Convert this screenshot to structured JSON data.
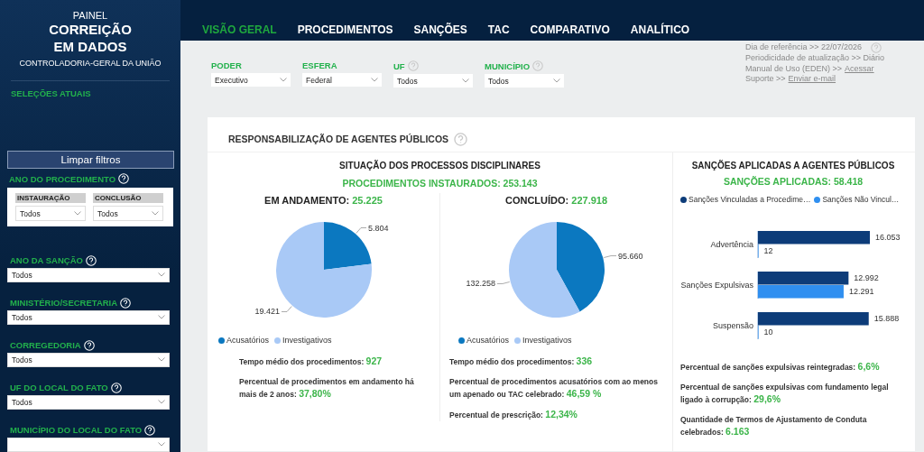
{
  "sidebar": {
    "logo": {
      "line_1": "PAINEL",
      "line_2": "CORREIÇÃO",
      "line_3": "EM DADOS",
      "line_4": "CONTROLADORIA-GERAL DA UNIÃO"
    },
    "selections_title": "SELEÇÕES ATUAIS",
    "clear_button": "Limpar filtros",
    "procedure_year": {
      "label": "ANO DO PROCEDIMENTO",
      "help": true,
      "fields": [
        {
          "label": "INSTAURAÇÃO",
          "value": "Todos"
        },
        {
          "label": "CONCLUSÃO",
          "value": "Todos"
        }
      ]
    },
    "filters": [
      {
        "label": "ANO DA SANÇÃO",
        "help": true,
        "value": "Todos"
      },
      {
        "label": "MINISTÉRIO/SECRETARIA",
        "help": true,
        "value": "Todos"
      },
      {
        "label": "CORREGEDORIA",
        "help": true,
        "value": "Todos"
      },
      {
        "label": "UF DO LOCAL DO FATO",
        "help": true,
        "value": "Todos"
      },
      {
        "label": "MUNICÍPIO DO LOCAL DO FATO",
        "help": true
      }
    ]
  },
  "tabs": [
    {
      "label": "VISÃO GERAL",
      "selected": true
    },
    {
      "label": "PROCEDIMENTOS",
      "selected": false
    },
    {
      "label": "SANÇÕES",
      "selected": false
    },
    {
      "label": "TAC",
      "selected": false
    },
    {
      "label": "COMPARATIVO",
      "selected": false
    },
    {
      "label": "ANALÍTICO",
      "selected": false
    }
  ],
  "top_filters": [
    {
      "label": "PODER",
      "value": "Executivo"
    },
    {
      "label": "ESFERA",
      "value": "Federal"
    },
    {
      "label": "UF",
      "help": true,
      "value": "Todos"
    },
    {
      "label": "MUNICÍPIO",
      "help": true,
      "value": "Todos"
    }
  ],
  "info": [
    {
      "text": "Dia de referência >> 22/07/2026",
      "help": true
    },
    {
      "text": "Periodicidade de atualização >> Diário"
    },
    {
      "text": "Manual de Uso (EDEN) >>",
      "link": "Acessar"
    },
    {
      "text": "Suporte >>",
      "link": "Enviar e-mail"
    }
  ],
  "card": {
    "title": "RESPONSABILIZAÇÃO DE AGENTES PÚBLICOS",
    "help": true,
    "processes": {
      "title": "SITUAÇÃO DOS PROCESSOS DISCIPLINARES",
      "total": "PROCEDIMENTOS INSTAURADOS: 253.143",
      "panels": [
        {
          "label": "EM ANDAMENTO:",
          "value": "25.225",
          "legend": [
            {
              "label": "Acusatórios",
              "color": "#0b78c0"
            },
            {
              "label": "Investigativos",
              "color": "#a9c9f6"
            }
          ],
          "chart_data": {
            "type": "pie",
            "values": [
              5804,
              19421
            ],
            "value_labels": [
              "5.804",
              "19.421"
            ]
          },
          "stats": [
            {
              "text": "Tempo médio dos procedimentos:",
              "value": "927"
            },
            {
              "text": "Percentual de procedimentos em andamento há mais de 2 anos:",
              "value": "37,80%"
            }
          ]
        },
        {
          "label": "CONCLUÍDO:",
          "value": "227.918",
          "legend": [
            {
              "label": "Acusatórios",
              "color": "#0b78c0"
            },
            {
              "label": "Investigativos",
              "color": "#a9c9f6"
            }
          ],
          "chart_data": {
            "type": "pie",
            "values": [
              95660,
              132258
            ],
            "value_labels": [
              "95.660",
              "132.258"
            ]
          },
          "stats": [
            {
              "text": "Tempo médio dos procedimentos:",
              "value": "336"
            },
            {
              "text": "Percentual de procedimentos acusatórios com ao menos um apenado ou TAC celebrado:",
              "value": "46,59 %"
            },
            {
              "text": "Percentual de prescrição:",
              "value": "12,34%"
            }
          ]
        }
      ]
    },
    "sanctions": {
      "title": "SANÇÕES APLICADAS A AGENTES PÚBLICOS",
      "total": "SANÇÕES APLICADAS: 58.418",
      "chart_data": {
        "type": "bar",
        "orientation": "horizontal",
        "categories": [
          "Advertência",
          "Sanções Expulsivas",
          "Suspensão"
        ],
        "series": [
          {
            "name": "Sanções Vinculadas a Procedime…",
            "color": "#0d3c79",
            "values": [
              16053,
              12992,
              15888
            ],
            "value_labels": [
              "16.053",
              "12.992",
              "15.888"
            ]
          },
          {
            "name": "Sanções Não Vincul…",
            "color": "#2f8ff0",
            "values": [
              12,
              12291,
              10
            ],
            "value_labels": [
              "12",
              "12.291",
              "10"
            ]
          }
        ]
      },
      "stats": [
        {
          "text": "Percentual de sanções expulsivas reintegradas:",
          "value": "6,6%"
        },
        {
          "text": "Percentual de sanções expulsivas com fundamento legal ligado à corrupção:",
          "value": "29,6%"
        },
        {
          "text": "Quantidade de Termos de Ajustamento de Conduta celebrados:",
          "value": "6.163"
        }
      ]
    }
  }
}
